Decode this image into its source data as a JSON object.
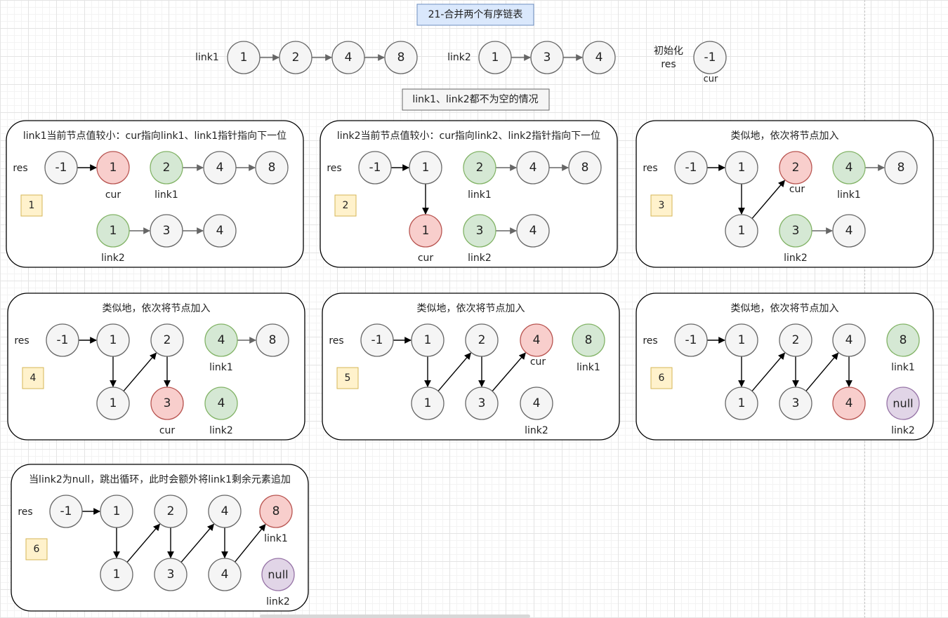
{
  "colors": {
    "node_default": "#f5f5f5",
    "node_default_stroke": "#666666",
    "node_red": "#f8cecc",
    "node_red_stroke": "#b85450",
    "node_green": "#d5e8d4",
    "node_green_stroke": "#82b366",
    "node_purple": "#e1d5e7",
    "node_purple_stroke": "#9673a6",
    "title_fill": "#dae8fc",
    "title_stroke": "#6c8ebf",
    "step_fill": "#fff2cc",
    "step_stroke": "#d6b656",
    "subtitle_fill": "#f5f5f5",
    "subtitle_stroke": "#666666"
  },
  "title": "21-合并两个有序链表",
  "subtitle": "link1、link2都不为空的情况",
  "intro": {
    "link1_label": "link1",
    "link1_values": [
      "1",
      "2",
      "4",
      "8"
    ],
    "link2_label": "link2",
    "link2_values": [
      "1",
      "3",
      "4"
    ],
    "init_label_line1": "初始化",
    "init_label_line2": "res",
    "init_value": "-1",
    "init_pointer": "cur"
  },
  "panels": [
    {
      "caption": "link1当前节点值较小：cur指向link1、link1指针指向下一位",
      "step": "1",
      "res_label": "res",
      "nodes": [
        {
          "id": "a",
          "text": "-1",
          "color": "default"
        },
        {
          "id": "b",
          "text": "1",
          "color": "red",
          "label": "cur"
        },
        {
          "id": "c",
          "text": "2",
          "color": "green",
          "label": "link1"
        },
        {
          "id": "d",
          "text": "4",
          "color": "default"
        },
        {
          "id": "e",
          "text": "8",
          "color": "default"
        },
        {
          "id": "f",
          "text": "1",
          "color": "green",
          "label": "link2"
        },
        {
          "id": "g",
          "text": "3",
          "color": "default"
        },
        {
          "id": "h",
          "text": "4",
          "color": "default"
        }
      ]
    },
    {
      "caption": "link2当前节点值较小：cur指向link2、link2指针指向下一位",
      "step": "2",
      "res_label": "res",
      "nodes": [
        {
          "id": "a",
          "text": "-1",
          "color": "default"
        },
        {
          "id": "b",
          "text": "1",
          "color": "default"
        },
        {
          "id": "c",
          "text": "2",
          "color": "green",
          "label": "link1"
        },
        {
          "id": "d",
          "text": "4",
          "color": "default"
        },
        {
          "id": "e",
          "text": "8",
          "color": "default"
        },
        {
          "id": "f",
          "text": "1",
          "color": "red",
          "label": "cur"
        },
        {
          "id": "g",
          "text": "3",
          "color": "green",
          "label": "link2"
        },
        {
          "id": "h",
          "text": "4",
          "color": "default"
        }
      ]
    },
    {
      "caption": "类似地，依次将节点加入",
      "step": "3",
      "res_label": "res",
      "nodes": [
        {
          "id": "a",
          "text": "-1",
          "color": "default"
        },
        {
          "id": "b",
          "text": "1",
          "color": "default"
        },
        {
          "id": "c",
          "text": "2",
          "color": "red",
          "label": "cur"
        },
        {
          "id": "d",
          "text": "4",
          "color": "green",
          "label": "link1"
        },
        {
          "id": "e",
          "text": "8",
          "color": "default"
        },
        {
          "id": "f",
          "text": "1",
          "color": "default"
        },
        {
          "id": "g",
          "text": "3",
          "color": "green",
          "label": "link2"
        },
        {
          "id": "h",
          "text": "4",
          "color": "default"
        }
      ]
    },
    {
      "caption": "类似地，依次将节点加入",
      "step": "4",
      "res_label": "res",
      "nodes": [
        {
          "id": "a",
          "text": "-1",
          "color": "default"
        },
        {
          "id": "b",
          "text": "1",
          "color": "default"
        },
        {
          "id": "c",
          "text": "2",
          "color": "default"
        },
        {
          "id": "d",
          "text": "4",
          "color": "green",
          "label": "link1"
        },
        {
          "id": "e",
          "text": "8",
          "color": "default"
        },
        {
          "id": "f",
          "text": "1",
          "color": "default"
        },
        {
          "id": "g",
          "text": "3",
          "color": "red",
          "label": "cur"
        },
        {
          "id": "h",
          "text": "4",
          "color": "green",
          "label": "link2"
        }
      ]
    },
    {
      "caption": "类似地，依次将节点加入",
      "step": "5",
      "res_label": "res",
      "nodes": [
        {
          "id": "a",
          "text": "-1",
          "color": "default"
        },
        {
          "id": "b",
          "text": "1",
          "color": "default"
        },
        {
          "id": "c",
          "text": "2",
          "color": "default"
        },
        {
          "id": "d",
          "text": "4",
          "color": "red",
          "label": "cur"
        },
        {
          "id": "e",
          "text": "8",
          "color": "green",
          "label": "link1"
        },
        {
          "id": "f",
          "text": "1",
          "color": "default"
        },
        {
          "id": "g",
          "text": "3",
          "color": "default"
        },
        {
          "id": "h",
          "text": "4",
          "color": "default",
          "label": "link2"
        }
      ]
    },
    {
      "caption": "类似地，依次将节点加入",
      "step": "6",
      "res_label": "res",
      "nodes": [
        {
          "id": "a",
          "text": "-1",
          "color": "default"
        },
        {
          "id": "b",
          "text": "1",
          "color": "default"
        },
        {
          "id": "c",
          "text": "2",
          "color": "default"
        },
        {
          "id": "d",
          "text": "4",
          "color": "default"
        },
        {
          "id": "e",
          "text": "8",
          "color": "green",
          "label": "link1"
        },
        {
          "id": "f",
          "text": "1",
          "color": "default"
        },
        {
          "id": "g",
          "text": "3",
          "color": "default"
        },
        {
          "id": "h",
          "text": "4",
          "color": "red"
        },
        {
          "id": "i",
          "text": "null",
          "color": "purple",
          "label": "link2"
        }
      ]
    },
    {
      "caption": "当link2为null，跳出循环，此时会额外将link1剩余元素追加",
      "step": "6",
      "res_label": "res",
      "nodes": [
        {
          "id": "a",
          "text": "-1",
          "color": "default"
        },
        {
          "id": "b",
          "text": "1",
          "color": "default"
        },
        {
          "id": "c",
          "text": "2",
          "color": "default"
        },
        {
          "id": "d",
          "text": "4",
          "color": "default"
        },
        {
          "id": "e",
          "text": "8",
          "color": "red",
          "label": "link1"
        },
        {
          "id": "f",
          "text": "1",
          "color": "default"
        },
        {
          "id": "g",
          "text": "3",
          "color": "default"
        },
        {
          "id": "h",
          "text": "4",
          "color": "default"
        },
        {
          "id": "i",
          "text": "null",
          "color": "purple",
          "label": "link2"
        }
      ]
    }
  ]
}
